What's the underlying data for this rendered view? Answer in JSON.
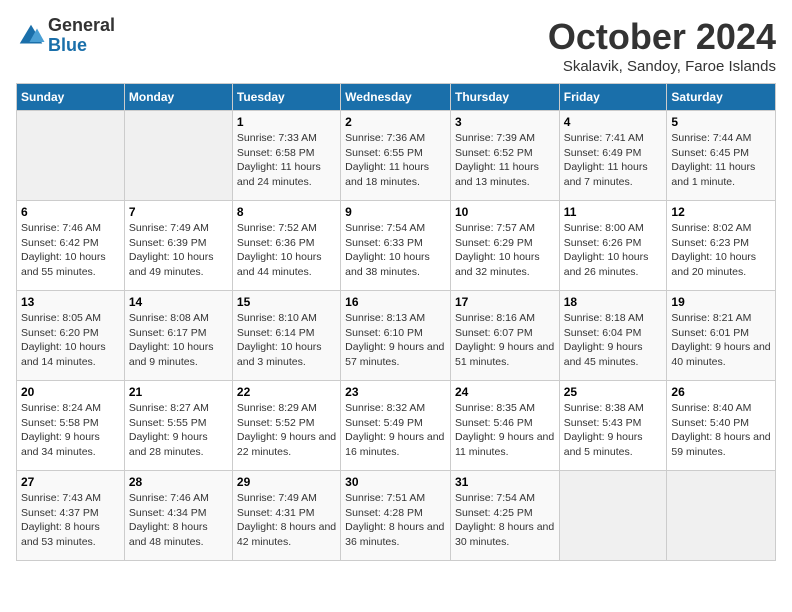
{
  "logo": {
    "general": "General",
    "blue": "Blue"
  },
  "title": "October 2024",
  "subtitle": "Skalavik, Sandoy, Faroe Islands",
  "days_of_week": [
    "Sunday",
    "Monday",
    "Tuesday",
    "Wednesday",
    "Thursday",
    "Friday",
    "Saturday"
  ],
  "weeks": [
    [
      {
        "day": "",
        "info": ""
      },
      {
        "day": "",
        "info": ""
      },
      {
        "day": "1",
        "info": "Sunrise: 7:33 AM\nSunset: 6:58 PM\nDaylight: 11 hours and 24 minutes."
      },
      {
        "day": "2",
        "info": "Sunrise: 7:36 AM\nSunset: 6:55 PM\nDaylight: 11 hours and 18 minutes."
      },
      {
        "day": "3",
        "info": "Sunrise: 7:39 AM\nSunset: 6:52 PM\nDaylight: 11 hours and 13 minutes."
      },
      {
        "day": "4",
        "info": "Sunrise: 7:41 AM\nSunset: 6:49 PM\nDaylight: 11 hours and 7 minutes."
      },
      {
        "day": "5",
        "info": "Sunrise: 7:44 AM\nSunset: 6:45 PM\nDaylight: 11 hours and 1 minute."
      }
    ],
    [
      {
        "day": "6",
        "info": "Sunrise: 7:46 AM\nSunset: 6:42 PM\nDaylight: 10 hours and 55 minutes."
      },
      {
        "day": "7",
        "info": "Sunrise: 7:49 AM\nSunset: 6:39 PM\nDaylight: 10 hours and 49 minutes."
      },
      {
        "day": "8",
        "info": "Sunrise: 7:52 AM\nSunset: 6:36 PM\nDaylight: 10 hours and 44 minutes."
      },
      {
        "day": "9",
        "info": "Sunrise: 7:54 AM\nSunset: 6:33 PM\nDaylight: 10 hours and 38 minutes."
      },
      {
        "day": "10",
        "info": "Sunrise: 7:57 AM\nSunset: 6:29 PM\nDaylight: 10 hours and 32 minutes."
      },
      {
        "day": "11",
        "info": "Sunrise: 8:00 AM\nSunset: 6:26 PM\nDaylight: 10 hours and 26 minutes."
      },
      {
        "day": "12",
        "info": "Sunrise: 8:02 AM\nSunset: 6:23 PM\nDaylight: 10 hours and 20 minutes."
      }
    ],
    [
      {
        "day": "13",
        "info": "Sunrise: 8:05 AM\nSunset: 6:20 PM\nDaylight: 10 hours and 14 minutes."
      },
      {
        "day": "14",
        "info": "Sunrise: 8:08 AM\nSunset: 6:17 PM\nDaylight: 10 hours and 9 minutes."
      },
      {
        "day": "15",
        "info": "Sunrise: 8:10 AM\nSunset: 6:14 PM\nDaylight: 10 hours and 3 minutes."
      },
      {
        "day": "16",
        "info": "Sunrise: 8:13 AM\nSunset: 6:10 PM\nDaylight: 9 hours and 57 minutes."
      },
      {
        "day": "17",
        "info": "Sunrise: 8:16 AM\nSunset: 6:07 PM\nDaylight: 9 hours and 51 minutes."
      },
      {
        "day": "18",
        "info": "Sunrise: 8:18 AM\nSunset: 6:04 PM\nDaylight: 9 hours and 45 minutes."
      },
      {
        "day": "19",
        "info": "Sunrise: 8:21 AM\nSunset: 6:01 PM\nDaylight: 9 hours and 40 minutes."
      }
    ],
    [
      {
        "day": "20",
        "info": "Sunrise: 8:24 AM\nSunset: 5:58 PM\nDaylight: 9 hours and 34 minutes."
      },
      {
        "day": "21",
        "info": "Sunrise: 8:27 AM\nSunset: 5:55 PM\nDaylight: 9 hours and 28 minutes."
      },
      {
        "day": "22",
        "info": "Sunrise: 8:29 AM\nSunset: 5:52 PM\nDaylight: 9 hours and 22 minutes."
      },
      {
        "day": "23",
        "info": "Sunrise: 8:32 AM\nSunset: 5:49 PM\nDaylight: 9 hours and 16 minutes."
      },
      {
        "day": "24",
        "info": "Sunrise: 8:35 AM\nSunset: 5:46 PM\nDaylight: 9 hours and 11 minutes."
      },
      {
        "day": "25",
        "info": "Sunrise: 8:38 AM\nSunset: 5:43 PM\nDaylight: 9 hours and 5 minutes."
      },
      {
        "day": "26",
        "info": "Sunrise: 8:40 AM\nSunset: 5:40 PM\nDaylight: 8 hours and 59 minutes."
      }
    ],
    [
      {
        "day": "27",
        "info": "Sunrise: 7:43 AM\nSunset: 4:37 PM\nDaylight: 8 hours and 53 minutes."
      },
      {
        "day": "28",
        "info": "Sunrise: 7:46 AM\nSunset: 4:34 PM\nDaylight: 8 hours and 48 minutes."
      },
      {
        "day": "29",
        "info": "Sunrise: 7:49 AM\nSunset: 4:31 PM\nDaylight: 8 hours and 42 minutes."
      },
      {
        "day": "30",
        "info": "Sunrise: 7:51 AM\nSunset: 4:28 PM\nDaylight: 8 hours and 36 minutes."
      },
      {
        "day": "31",
        "info": "Sunrise: 7:54 AM\nSunset: 4:25 PM\nDaylight: 8 hours and 30 minutes."
      },
      {
        "day": "",
        "info": ""
      },
      {
        "day": "",
        "info": ""
      }
    ]
  ]
}
